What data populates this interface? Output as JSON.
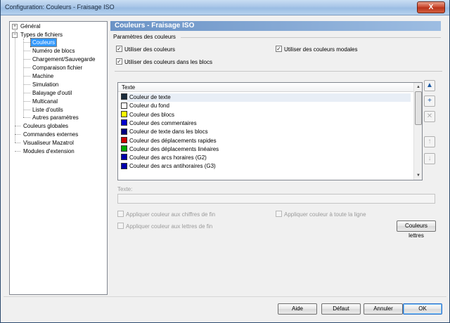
{
  "window": {
    "title": "Configuration: Couleurs - Fraisage ISO",
    "close_label": "X"
  },
  "tree": {
    "items": [
      {
        "label": "Général",
        "level": 0,
        "expander": "+"
      },
      {
        "label": "Types de fichiers",
        "level": 0,
        "expander": "−"
      },
      {
        "label": "Couleurs",
        "level": 1,
        "selected": true
      },
      {
        "label": "Numéro de blocs",
        "level": 1
      },
      {
        "label": "Chargement/Sauvegarde",
        "level": 1
      },
      {
        "label": "Comparaison fichier",
        "level": 1
      },
      {
        "label": "Machine",
        "level": 1
      },
      {
        "label": "Simulation",
        "level": 1
      },
      {
        "label": "Balayage d'outil",
        "level": 1
      },
      {
        "label": "Multicanal",
        "level": 1
      },
      {
        "label": "Liste d'outils",
        "level": 1
      },
      {
        "label": "Autres paramètres",
        "level": 1
      },
      {
        "label": "Couleurs globales",
        "level": 0
      },
      {
        "label": "Commandes externes",
        "level": 0
      },
      {
        "label": "Visualiseur Mazatrol",
        "level": 0
      },
      {
        "label": "Modules d'extension",
        "level": 0
      }
    ]
  },
  "panel": {
    "header": "Couleurs - Fraisage ISO",
    "group_title": "Paramètres des couleurs",
    "checkboxes": {
      "use_colors": {
        "label": "Utiliser des couleurs",
        "checked": true
      },
      "use_modal_colors": {
        "label": "Utiliser des couleurs modales",
        "checked": true
      },
      "use_colors_in_blocks": {
        "label": "Utiliser des couleurs dans les blocs",
        "checked": true
      }
    },
    "list": {
      "header": "Texte",
      "rows": [
        {
          "label": "Couleur de texte",
          "color": "#1a2b3c",
          "selected": true
        },
        {
          "label": "Couleur du fond",
          "color": "#ffffff"
        },
        {
          "label": "Couleur des blocs",
          "color": "#ffff00"
        },
        {
          "label": "Couleur des commentaires",
          "color": "#0000cc"
        },
        {
          "label": "Couleur de texte dans les blocs",
          "color": "#000080"
        },
        {
          "label": "Couleur des déplacements rapides",
          "color": "#cc0000"
        },
        {
          "label": "Couleur des déplacements linéaires",
          "color": "#00aa00"
        },
        {
          "label": "Couleur des arcs horaires (G2)",
          "color": "#0000aa"
        },
        {
          "label": "Couleur des arcs antihoraires (G3)",
          "color": "#0000aa"
        }
      ]
    },
    "text_label": "Texte:",
    "text_value": "",
    "options": {
      "apply_end_digits": {
        "label": "Appliquer couleur aux chiffres de fin",
        "checked": false
      },
      "apply_whole_line": {
        "label": "Appliquer couleur à toute la ligne",
        "checked": false
      },
      "apply_end_letters": {
        "label": "Appliquer couleur aux lettres de fin",
        "checked": false
      }
    },
    "letter_colors_button": "Couleurs lettres"
  },
  "footer": {
    "help": "Aide",
    "default": "Défaut",
    "cancel": "Annuler",
    "ok": "OK"
  }
}
